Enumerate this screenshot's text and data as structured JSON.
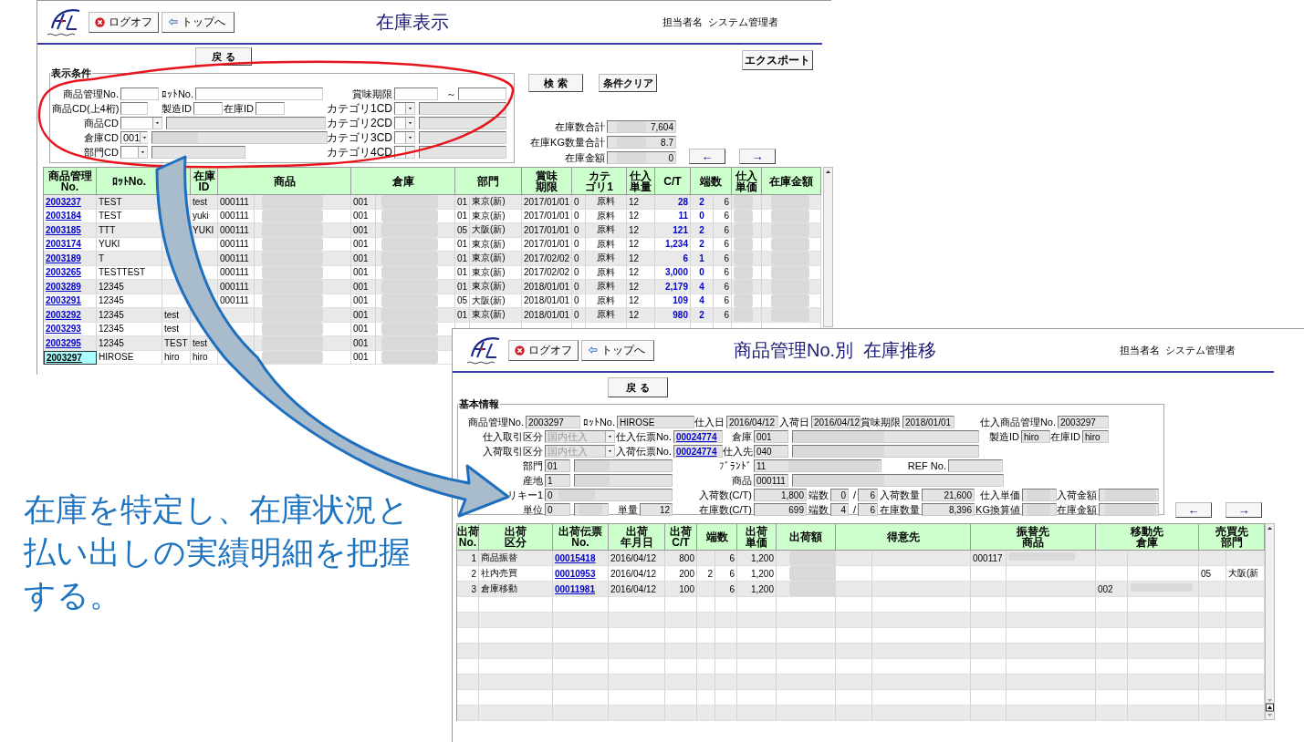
{
  "stock_list": {
    "header": {
      "title": "在庫表示",
      "logoff": "ログオフ",
      "top": "トップへ",
      "user_label": "担当者名",
      "user_name": "システム管理者"
    },
    "back": "戻 る",
    "export": "エクスポート",
    "search": "検 索",
    "clear": "条件クリア",
    "conditions": {
      "legend": "表示条件",
      "fields": [
        {
          "label": "商品管理No.",
          "kind": "input"
        },
        {
          "label": "ﾛｯﾄNo.",
          "kind": "input"
        },
        {
          "label": "賞味期限",
          "kind": "input"
        },
        {
          "label": "～",
          "kind": "input"
        },
        {
          "label": "商品CD(上4桁)",
          "kind": "input"
        },
        {
          "label": "製造ID",
          "kind": "input"
        },
        {
          "label": "在庫ID",
          "kind": "input"
        },
        {
          "label": "カテゴリ1CD",
          "kind": "select"
        },
        {
          "label": "商品CD",
          "kind": "select"
        },
        {
          "label": "カテゴリ2CD",
          "kind": "select"
        },
        {
          "label": "倉庫CD",
          "kind": "select",
          "value": "001"
        },
        {
          "label": "カテゴリ3CD",
          "kind": "select"
        },
        {
          "label": "部門CD",
          "kind": "select"
        },
        {
          "label": "カテゴリ4CD",
          "kind": "select"
        }
      ]
    },
    "totals": [
      {
        "label": "在庫数合計",
        "value": "7,604"
      },
      {
        "label": "在庫KG数量合計",
        "value": "8.7"
      },
      {
        "label": "在庫金額",
        "value": "0"
      }
    ],
    "nav": [
      "←",
      "→"
    ],
    "table": {
      "columns": [
        [
          "商品管理",
          "No."
        ],
        [
          "ﾛｯﾄNo."
        ],
        null,
        [
          "在庫",
          "ID"
        ],
        null,
        [
          "商品"
        ],
        null,
        [
          "倉庫"
        ],
        null,
        [
          "部門"
        ],
        [
          "賞味",
          "期限"
        ],
        null,
        [
          "カテ",
          "ゴリ1"
        ],
        [
          "仕入",
          "単量"
        ],
        [
          "C/T"
        ],
        [
          "端数"
        ],
        null,
        [
          "仕入",
          "単価"
        ],
        [
          "在庫金額"
        ]
      ],
      "rows": [
        {
          "selected": false,
          "cells": [
            "2003237",
            "TEST",
            null,
            "test",
            "000111",
            null,
            "001",
            null,
            "01",
            "東京(新)",
            "2017/01/01",
            "0",
            "原料",
            "12",
            "28",
            "2",
            "6",
            null,
            null
          ]
        },
        {
          "selected": false,
          "cells": [
            "2003184",
            "TEST",
            null,
            "yuki",
            "000111",
            null,
            "001",
            null,
            "01",
            "東京(新)",
            "2017/01/01",
            "0",
            "原料",
            "12",
            "11",
            "0",
            "6",
            null,
            null
          ]
        },
        {
          "selected": false,
          "cells": [
            "2003185",
            "TTT",
            null,
            "YUKI",
            "000111",
            null,
            "001",
            null,
            "05",
            "大阪(新)",
            "2017/01/01",
            "0",
            "原料",
            "12",
            "121",
            "2",
            "6",
            null,
            null
          ]
        },
        {
          "selected": false,
          "cells": [
            "2003174",
            "YUKI",
            null,
            null,
            "000111",
            null,
            "001",
            null,
            "01",
            "東京(新)",
            "2017/01/01",
            "0",
            "原料",
            "12",
            "1,234",
            "2",
            "6",
            null,
            null
          ]
        },
        {
          "selected": false,
          "cells": [
            "2003189",
            "T",
            null,
            null,
            "000111",
            null,
            "001",
            null,
            "01",
            "東京(新)",
            "2017/02/02",
            "0",
            "原料",
            "12",
            "6",
            "1",
            "6",
            null,
            null
          ]
        },
        {
          "selected": false,
          "cells": [
            "2003265",
            "TESTTEST",
            null,
            null,
            "000111",
            null,
            "001",
            null,
            "01",
            "東京(新)",
            "2017/02/02",
            "0",
            "原料",
            "12",
            "3,000",
            "0",
            "6",
            null,
            null
          ]
        },
        {
          "selected": false,
          "cells": [
            "2003289",
            "12345",
            null,
            null,
            "000111",
            null,
            "001",
            null,
            "01",
            "東京(新)",
            "2018/01/01",
            "0",
            "原料",
            "12",
            "2,179",
            "4",
            "6",
            null,
            null
          ]
        },
        {
          "selected": false,
          "cells": [
            "2003291",
            "12345",
            null,
            null,
            "000111",
            null,
            "001",
            null,
            "05",
            "大阪(新)",
            "2018/01/01",
            "0",
            "原料",
            "12",
            "109",
            "4",
            "6",
            null,
            null
          ]
        },
        {
          "selected": false,
          "cells": [
            "2003292",
            "12345",
            "test",
            null,
            null,
            null,
            "001",
            null,
            "01",
            "東京(新)",
            "2018/01/01",
            "0",
            "原料",
            "12",
            "980",
            "2",
            "6",
            null,
            null
          ]
        },
        {
          "selected": false,
          "cells": [
            "2003293",
            "12345",
            "test",
            null,
            null,
            null,
            "001",
            null,
            null,
            null,
            null,
            null,
            null,
            null,
            null,
            null,
            null,
            null,
            null
          ]
        },
        {
          "selected": false,
          "cells": [
            "2003295",
            "12345",
            "TEST",
            "test",
            null,
            null,
            "001",
            null,
            null,
            null,
            null,
            null,
            null,
            null,
            null,
            null,
            null,
            null,
            null
          ]
        },
        {
          "selected": true,
          "cells": [
            "2003297",
            "HIROSE",
            "hiro",
            "hiro",
            null,
            null,
            "001",
            null,
            null,
            null,
            null,
            null,
            null,
            null,
            null,
            null,
            null,
            null,
            null
          ]
        }
      ]
    }
  },
  "stock_history": {
    "header": {
      "title": "商品管理No.別  在庫推移",
      "logoff": "ログオフ",
      "top": "トップへ",
      "user_label": "担当者名",
      "user_name": "システム管理者"
    },
    "back": "戻 る",
    "info": {
      "legend": "基本情報",
      "lines": [
        {
          "fields": [
            {
              "label": "商品管理No.",
              "kind": "output",
              "value": "2003297"
            },
            {
              "label": "ﾛｯﾄNo.",
              "kind": "output",
              "value": "HIROSE"
            },
            {
              "label": "仕入日",
              "kind": "output",
              "value": "2016/04/12"
            },
            {
              "label": "入荷日",
              "kind": "output",
              "value": "2016/04/12"
            },
            {
              "label": "賞味期限",
              "kind": "output",
              "value": "2018/01/01"
            },
            {
              "label": "仕入商品管理No.",
              "kind": "output",
              "value": "2003297"
            }
          ]
        },
        {
          "fields": [
            {
              "label": "仕入取引区分",
              "kind": "select",
              "value": "国内仕入",
              "disabled": true
            },
            {
              "label": "仕入伝票No.",
              "kind": "link",
              "value": "00024774"
            },
            {
              "label": "倉庫",
              "kind": "code",
              "value": "001"
            },
            {
              "label": "製造ID",
              "kind": "output",
              "value": "hiro"
            },
            {
              "label": "在庫ID",
              "kind": "output",
              "value": "hiro"
            }
          ]
        },
        {
          "fields": [
            {
              "label": "入荷取引区分",
              "kind": "select",
              "value": "国内仕入",
              "disabled": true
            },
            {
              "label": "入荷伝票No.",
              "kind": "link",
              "value": "00024774"
            },
            {
              "label": "仕入先",
              "kind": "code",
              "value": "040"
            }
          ]
        },
        {
          "fields": [
            {
              "label": "部門",
              "kind": "code",
              "value": "01"
            },
            {
              "label": "ﾌﾞﾗﾝﾄﾞ",
              "kind": "output",
              "value": "11"
            },
            {
              "label": "REF No.",
              "kind": "output"
            }
          ]
        },
        {
          "fields": [
            {
              "label": "産地",
              "kind": "code",
              "value": "1"
            },
            {
              "label": "商品",
              "kind": "code",
              "value": "000111"
            }
          ]
        },
        {
          "fields": [
            {
              "label": "リキー1",
              "kind": "output",
              "value": "0"
            },
            {
              "label": "入荷数(C/T)",
              "kind": "output",
              "value": "1,800"
            },
            {
              "label": "端数",
              "kind": "output",
              "value": "0"
            },
            {
              "label": "/",
              "kind": "output",
              "value": "6"
            },
            {
              "label": "入荷数量",
              "kind": "output",
              "value": "21,600"
            },
            {
              "label": "仕入単価",
              "kind": "output"
            },
            {
              "label": "入荷金額",
              "kind": "output"
            }
          ]
        },
        {
          "fields": [
            {
              "label": "単位",
              "kind": "code",
              "value": "0"
            },
            {
              "label": "単量",
              "kind": "output",
              "value": "12"
            },
            {
              "label": "在庫数(C/T)",
              "kind": "output",
              "value": "699"
            },
            {
              "label": "端数",
              "kind": "output",
              "value": "4"
            },
            {
              "label": "/",
              "kind": "output",
              "value": "6"
            },
            {
              "label": "在庫数量",
              "kind": "output",
              "value": "8,396"
            },
            {
              "label": "KG換算値",
              "kind": "output"
            },
            {
              "label": "在庫金額",
              "kind": "output"
            }
          ]
        }
      ]
    },
    "nav": [
      "←",
      "→"
    ],
    "table": {
      "columns": [
        [
          "出荷",
          "No."
        ],
        [
          "出荷",
          "区分"
        ],
        [
          "出荷伝票",
          "No."
        ],
        [
          "出荷",
          "年月日"
        ],
        [
          "出荷",
          "C/T"
        ],
        [
          "端数"
        ],
        null,
        [
          "出荷",
          "単価"
        ],
        [
          "出荷額"
        ],
        null,
        [
          "得意先"
        ],
        null,
        [
          "振替先",
          "商品"
        ],
        null,
        [
          "移動先",
          "倉庫"
        ],
        null,
        [
          "売買先",
          "部門"
        ]
      ],
      "rows": [
        {
          "cells": [
            "1",
            "商品振替",
            "00015418",
            "2016/04/12",
            "800",
            null,
            "6",
            "1,200",
            null,
            null,
            null,
            "000117",
            null,
            null,
            null,
            null,
            null
          ]
        },
        {
          "cells": [
            "2",
            "社内売買",
            "00010953",
            "2016/04/12",
            "200",
            "2",
            "6",
            "1,200",
            null,
            null,
            null,
            null,
            null,
            null,
            null,
            "05",
            "大阪(新"
          ]
        },
        {
          "cells": [
            "3",
            "倉庫移動",
            "00011981",
            "2016/04/12",
            "100",
            null,
            "6",
            "1,200",
            null,
            null,
            null,
            null,
            null,
            "002",
            null,
            null,
            null
          ]
        }
      ]
    }
  },
  "caption": "在庫を特定し、在庫状況と払い出しの実績明細を把握する。"
}
